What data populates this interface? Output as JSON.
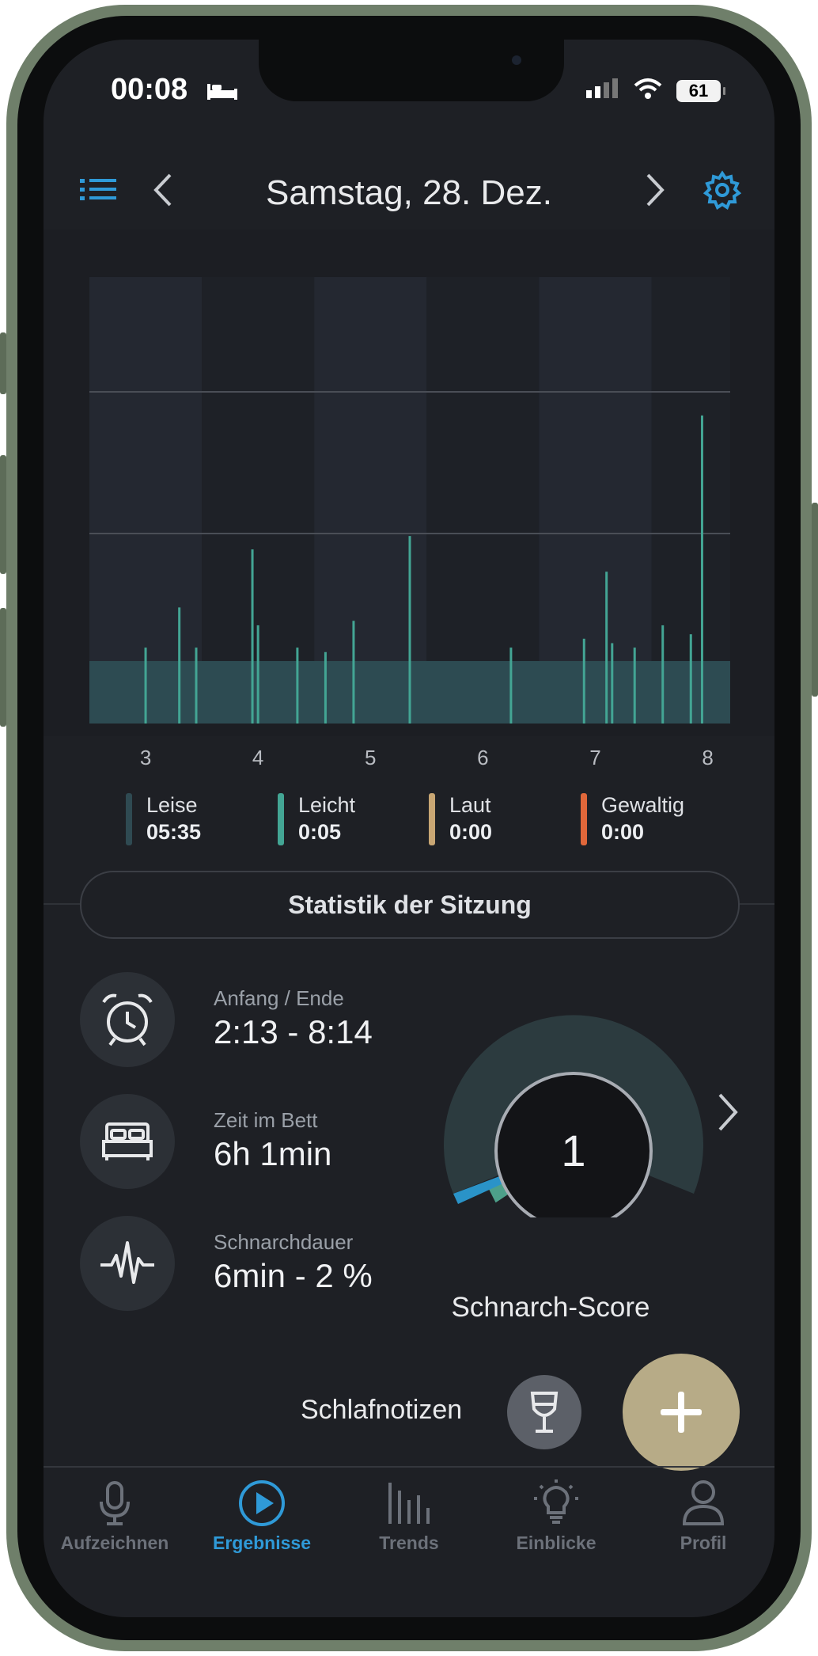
{
  "status_bar": {
    "time": "00:08",
    "battery": "61"
  },
  "header": {
    "title": "Samstag, 28. Dez."
  },
  "chart_data": {
    "type": "area",
    "x_ticks": [
      "3",
      "4",
      "5",
      "6",
      "7",
      "8"
    ],
    "xlim": [
      2.5,
      8.2
    ],
    "grid": true,
    "series_colors": {
      "Leise": "#2d4b52",
      "Leicht": "#43a594",
      "Laut": "#c8a673",
      "Gewaltig": "#e0673a"
    },
    "baseline_level": 0.14,
    "spikes": [
      {
        "x": 3.0,
        "level": 0.03
      },
      {
        "x": 3.3,
        "level": 0.12
      },
      {
        "x": 3.45,
        "level": 0.03
      },
      {
        "x": 3.95,
        "level": 0.25
      },
      {
        "x": 4.0,
        "level": 0.08
      },
      {
        "x": 4.35,
        "level": 0.03
      },
      {
        "x": 4.6,
        "level": 0.02
      },
      {
        "x": 4.85,
        "level": 0.09
      },
      {
        "x": 5.35,
        "level": 0.28
      },
      {
        "x": 6.25,
        "level": 0.03
      },
      {
        "x": 6.9,
        "level": 0.05
      },
      {
        "x": 7.1,
        "level": 0.2
      },
      {
        "x": 7.15,
        "level": 0.04
      },
      {
        "x": 7.35,
        "level": 0.03
      },
      {
        "x": 7.6,
        "level": 0.08
      },
      {
        "x": 7.85,
        "level": 0.06
      },
      {
        "x": 7.95,
        "level": 0.55
      }
    ]
  },
  "legend": [
    {
      "name": "Leise",
      "value": "05:35",
      "color": "#2f4a52"
    },
    {
      "name": "Leicht",
      "value": "0:05",
      "color": "#43a594"
    },
    {
      "name": "Laut",
      "value": "0:00",
      "color": "#c8a673"
    },
    {
      "name": "Gewaltig",
      "value": "0:00",
      "color": "#e0673a"
    }
  ],
  "session": {
    "title": "Statistik der Sitzung",
    "start_end_label": "Anfang / Ende",
    "start_end_value": "2:13 - 8:14",
    "bed_label": "Zeit im Bett",
    "bed_value": "6h 1min",
    "snore_label": "Schnarchdauer",
    "snore_value": "6min - 2 %"
  },
  "score": {
    "value": "1",
    "label": "Schnarch-Score",
    "level": 0.05
  },
  "notes": {
    "label": "Schlafnotizen"
  },
  "tabs": [
    {
      "label": "Aufzeichnen"
    },
    {
      "label": "Ergebnisse"
    },
    {
      "label": "Trends"
    },
    {
      "label": "Einblicke"
    },
    {
      "label": "Profil"
    }
  ]
}
